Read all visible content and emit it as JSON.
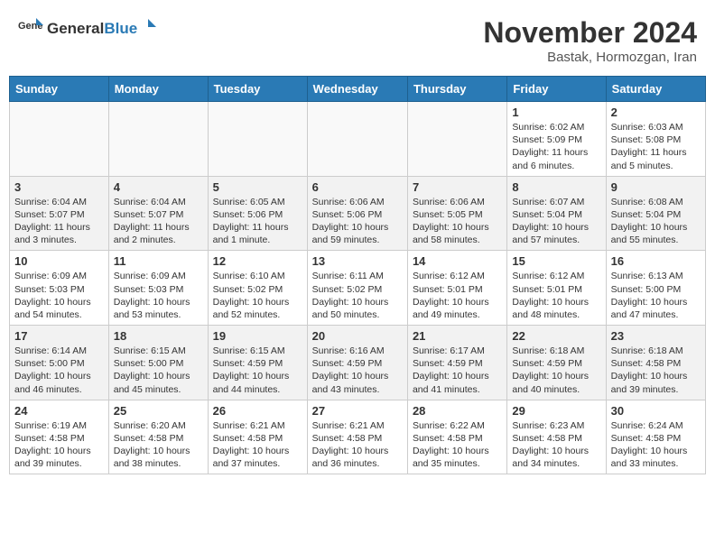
{
  "header": {
    "logo_general": "General",
    "logo_blue": "Blue",
    "month_year": "November 2024",
    "location": "Bastak, Hormozgan, Iran"
  },
  "weekdays": [
    "Sunday",
    "Monday",
    "Tuesday",
    "Wednesday",
    "Thursday",
    "Friday",
    "Saturday"
  ],
  "weeks": [
    [
      {
        "day": "",
        "info": ""
      },
      {
        "day": "",
        "info": ""
      },
      {
        "day": "",
        "info": ""
      },
      {
        "day": "",
        "info": ""
      },
      {
        "day": "",
        "info": ""
      },
      {
        "day": "1",
        "info": "Sunrise: 6:02 AM\nSunset: 5:09 PM\nDaylight: 11 hours\nand 6 minutes."
      },
      {
        "day": "2",
        "info": "Sunrise: 6:03 AM\nSunset: 5:08 PM\nDaylight: 11 hours\nand 5 minutes."
      }
    ],
    [
      {
        "day": "3",
        "info": "Sunrise: 6:04 AM\nSunset: 5:07 PM\nDaylight: 11 hours\nand 3 minutes."
      },
      {
        "day": "4",
        "info": "Sunrise: 6:04 AM\nSunset: 5:07 PM\nDaylight: 11 hours\nand 2 minutes."
      },
      {
        "day": "5",
        "info": "Sunrise: 6:05 AM\nSunset: 5:06 PM\nDaylight: 11 hours\nand 1 minute."
      },
      {
        "day": "6",
        "info": "Sunrise: 6:06 AM\nSunset: 5:06 PM\nDaylight: 10 hours\nand 59 minutes."
      },
      {
        "day": "7",
        "info": "Sunrise: 6:06 AM\nSunset: 5:05 PM\nDaylight: 10 hours\nand 58 minutes."
      },
      {
        "day": "8",
        "info": "Sunrise: 6:07 AM\nSunset: 5:04 PM\nDaylight: 10 hours\nand 57 minutes."
      },
      {
        "day": "9",
        "info": "Sunrise: 6:08 AM\nSunset: 5:04 PM\nDaylight: 10 hours\nand 55 minutes."
      }
    ],
    [
      {
        "day": "10",
        "info": "Sunrise: 6:09 AM\nSunset: 5:03 PM\nDaylight: 10 hours\nand 54 minutes."
      },
      {
        "day": "11",
        "info": "Sunrise: 6:09 AM\nSunset: 5:03 PM\nDaylight: 10 hours\nand 53 minutes."
      },
      {
        "day": "12",
        "info": "Sunrise: 6:10 AM\nSunset: 5:02 PM\nDaylight: 10 hours\nand 52 minutes."
      },
      {
        "day": "13",
        "info": "Sunrise: 6:11 AM\nSunset: 5:02 PM\nDaylight: 10 hours\nand 50 minutes."
      },
      {
        "day": "14",
        "info": "Sunrise: 6:12 AM\nSunset: 5:01 PM\nDaylight: 10 hours\nand 49 minutes."
      },
      {
        "day": "15",
        "info": "Sunrise: 6:12 AM\nSunset: 5:01 PM\nDaylight: 10 hours\nand 48 minutes."
      },
      {
        "day": "16",
        "info": "Sunrise: 6:13 AM\nSunset: 5:00 PM\nDaylight: 10 hours\nand 47 minutes."
      }
    ],
    [
      {
        "day": "17",
        "info": "Sunrise: 6:14 AM\nSunset: 5:00 PM\nDaylight: 10 hours\nand 46 minutes."
      },
      {
        "day": "18",
        "info": "Sunrise: 6:15 AM\nSunset: 5:00 PM\nDaylight: 10 hours\nand 45 minutes."
      },
      {
        "day": "19",
        "info": "Sunrise: 6:15 AM\nSunset: 4:59 PM\nDaylight: 10 hours\nand 44 minutes."
      },
      {
        "day": "20",
        "info": "Sunrise: 6:16 AM\nSunset: 4:59 PM\nDaylight: 10 hours\nand 43 minutes."
      },
      {
        "day": "21",
        "info": "Sunrise: 6:17 AM\nSunset: 4:59 PM\nDaylight: 10 hours\nand 41 minutes."
      },
      {
        "day": "22",
        "info": "Sunrise: 6:18 AM\nSunset: 4:59 PM\nDaylight: 10 hours\nand 40 minutes."
      },
      {
        "day": "23",
        "info": "Sunrise: 6:18 AM\nSunset: 4:58 PM\nDaylight: 10 hours\nand 39 minutes."
      }
    ],
    [
      {
        "day": "24",
        "info": "Sunrise: 6:19 AM\nSunset: 4:58 PM\nDaylight: 10 hours\nand 39 minutes."
      },
      {
        "day": "25",
        "info": "Sunrise: 6:20 AM\nSunset: 4:58 PM\nDaylight: 10 hours\nand 38 minutes."
      },
      {
        "day": "26",
        "info": "Sunrise: 6:21 AM\nSunset: 4:58 PM\nDaylight: 10 hours\nand 37 minutes."
      },
      {
        "day": "27",
        "info": "Sunrise: 6:21 AM\nSunset: 4:58 PM\nDaylight: 10 hours\nand 36 minutes."
      },
      {
        "day": "28",
        "info": "Sunrise: 6:22 AM\nSunset: 4:58 PM\nDaylight: 10 hours\nand 35 minutes."
      },
      {
        "day": "29",
        "info": "Sunrise: 6:23 AM\nSunset: 4:58 PM\nDaylight: 10 hours\nand 34 minutes."
      },
      {
        "day": "30",
        "info": "Sunrise: 6:24 AM\nSunset: 4:58 PM\nDaylight: 10 hours\nand 33 minutes."
      }
    ]
  ]
}
